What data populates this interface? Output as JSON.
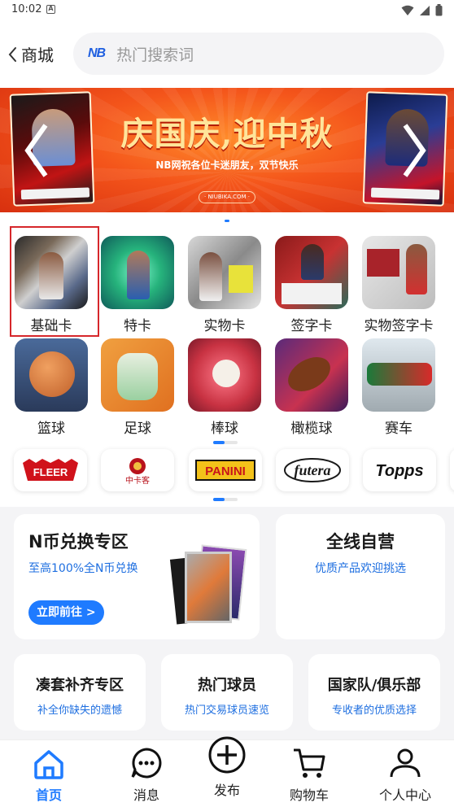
{
  "status_bar": {
    "time": "10:02",
    "a_icon": "A"
  },
  "header": {
    "back_label": "商城",
    "search_logo": "NB",
    "search_placeholder": "热门搜索词"
  },
  "banner": {
    "title": "庆国庆,迎中秋",
    "subtitle": "NB网祝各位卡迷朋友，双节快乐",
    "url": "· NIUBIKA.COM ·"
  },
  "categories": {
    "row1": [
      {
        "label": "基础卡",
        "icon": "base-card-thumb",
        "selected": true
      },
      {
        "label": "特卡",
        "icon": "insert-card-thumb"
      },
      {
        "label": "实物卡",
        "icon": "memorabilia-card-thumb"
      },
      {
        "label": "签字卡",
        "icon": "autograph-card-thumb"
      },
      {
        "label": "实物签字卡",
        "icon": "patch-auto-card-thumb"
      }
    ],
    "row2": [
      {
        "label": "篮球",
        "icon": "basketball-thumb"
      },
      {
        "label": "足球",
        "icon": "soccer-thumb"
      },
      {
        "label": "棒球",
        "icon": "baseball-thumb"
      },
      {
        "label": "橄榄球",
        "icon": "football-thumb"
      },
      {
        "label": "赛车",
        "icon": "racing-thumb"
      }
    ]
  },
  "brands": [
    {
      "name": "FLEER",
      "color": "#d0121b"
    },
    {
      "name": "中卡客",
      "color": "#b8131c"
    },
    {
      "name": "PANINI",
      "color": "#111111"
    },
    {
      "name": "futera",
      "color": "#1a1a1a"
    },
    {
      "name": "Topps",
      "color": "#111111"
    }
  ],
  "promo": {
    "exchange": {
      "title": "N币兑换专区",
      "subtitle": "至高100%全N币兑换",
      "button": "立即前往 >"
    },
    "self_run": {
      "title": "全线自营",
      "subtitle": "优质产品欢迎挑选"
    }
  },
  "mini_cards": [
    {
      "title": "凑套补齐专区",
      "subtitle": "补全你缺失的遗憾"
    },
    {
      "title": "热门球员",
      "subtitle": "热门交易球员速览"
    },
    {
      "title": "国家队/俱乐部",
      "subtitle": "专收者的优质选择"
    }
  ],
  "tabbar": [
    {
      "label": "首页",
      "icon": "home-icon",
      "active": true
    },
    {
      "label": "消息",
      "icon": "message-icon"
    },
    {
      "label": "发布",
      "icon": "publish-icon"
    },
    {
      "label": "购物车",
      "icon": "cart-icon"
    },
    {
      "label": "个人中心",
      "icon": "profile-icon"
    }
  ],
  "colors": {
    "accent": "#1f7bff",
    "selection": "#d6272b",
    "banner": "#f4551b"
  }
}
